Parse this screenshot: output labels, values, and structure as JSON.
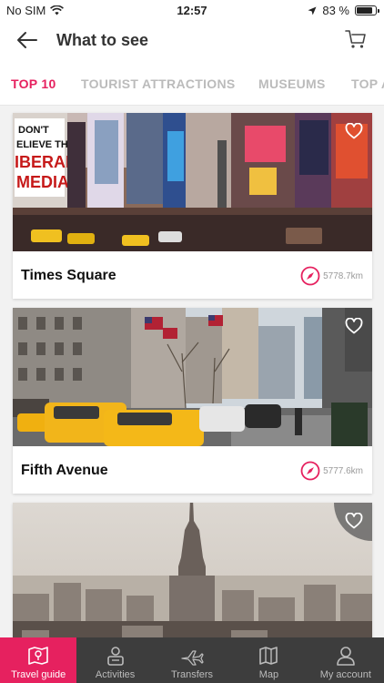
{
  "status": {
    "carrier": "No SIM",
    "time": "12:57",
    "battery": "83 %",
    "battery_level": 0.83
  },
  "header": {
    "title": "What to see"
  },
  "tabs": [
    {
      "label": "TOP 10",
      "active": true
    },
    {
      "label": "TOURIST ATTRACTIONS",
      "active": false
    },
    {
      "label": "MUSEUMS",
      "active": false
    },
    {
      "label": "TOP A",
      "active": false
    }
  ],
  "places": [
    {
      "name": "Times Square",
      "distance": "5778.7km"
    },
    {
      "name": "Fifth Avenue",
      "distance": "5777.6km"
    },
    {
      "name": "",
      "distance": ""
    }
  ],
  "tabbar": [
    {
      "label": "Travel guide",
      "icon": "map-book-icon",
      "active": true
    },
    {
      "label": "Activities",
      "icon": "person-badge-icon",
      "active": false
    },
    {
      "label": "Transfers",
      "icon": "plane-icon",
      "active": false
    },
    {
      "label": "Map",
      "icon": "map-icon",
      "active": false
    },
    {
      "label": "My account",
      "icon": "user-icon",
      "active": false
    }
  ],
  "colors": {
    "accent": "#e6215f",
    "tabbar_bg": "#3d3d3d"
  }
}
